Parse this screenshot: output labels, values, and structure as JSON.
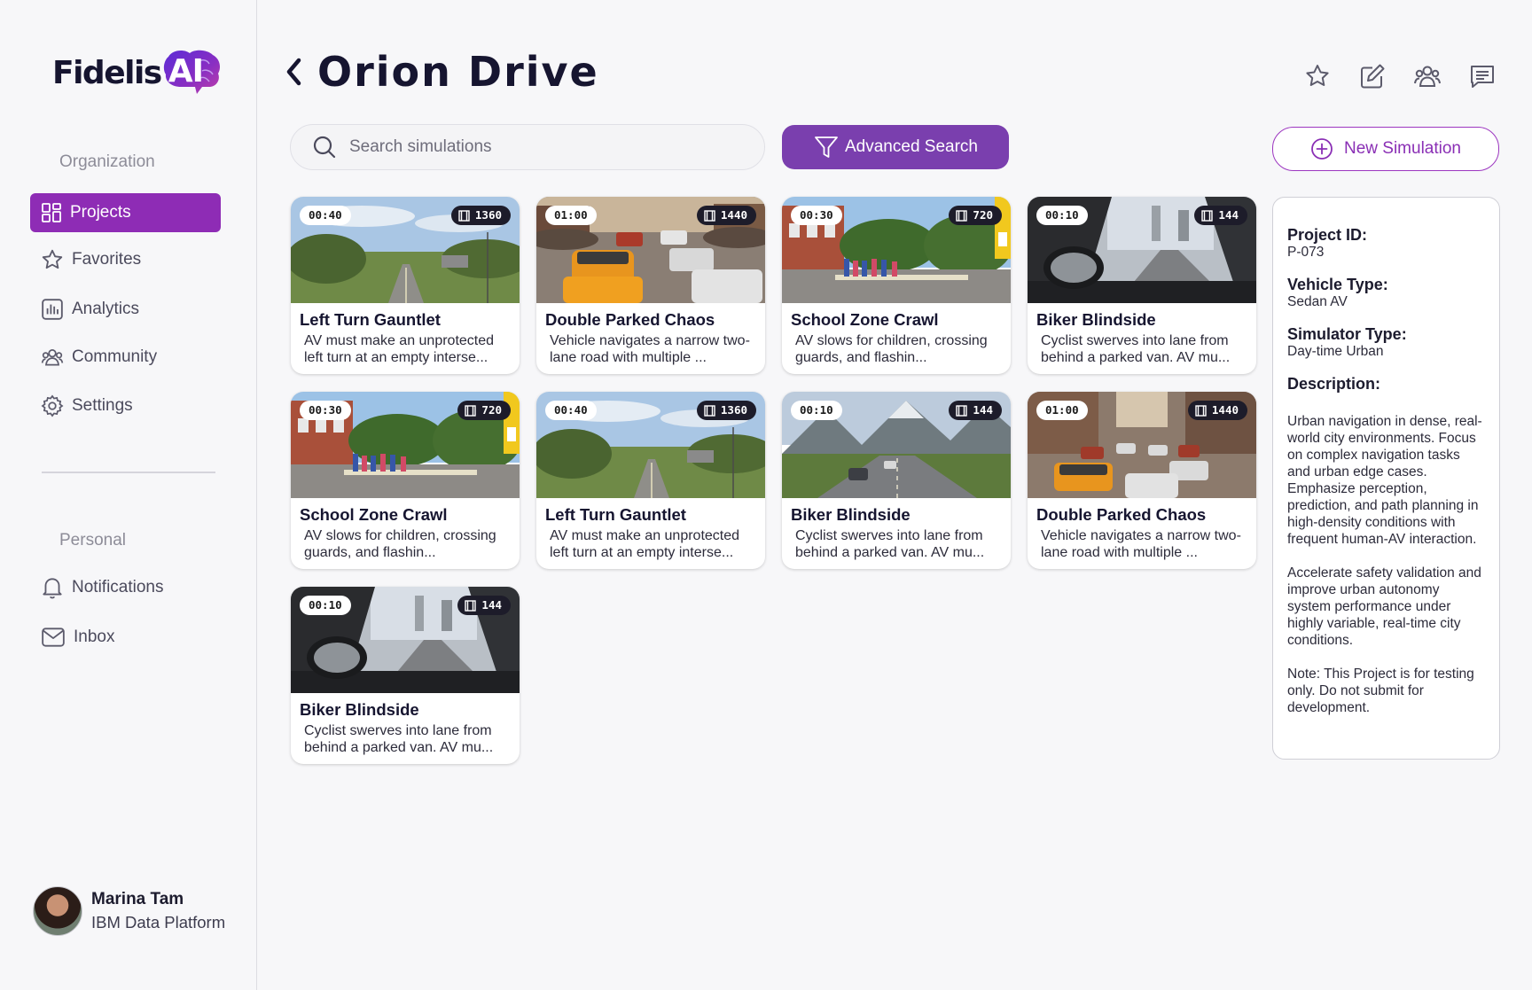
{
  "logo": {
    "text": "Fidelis",
    "badge": "AI"
  },
  "sidebar": {
    "org_label": "Organization",
    "items": [
      {
        "label": "Projects",
        "icon": "projects-icon",
        "active": true
      },
      {
        "label": "Favorites",
        "icon": "star-icon"
      },
      {
        "label": "Analytics",
        "icon": "analytics-icon"
      },
      {
        "label": "Community",
        "icon": "community-icon"
      },
      {
        "label": "Settings",
        "icon": "gear-icon"
      }
    ],
    "personal_label": "Personal",
    "personal_items": [
      {
        "label": "Notifications",
        "icon": "bell-icon"
      },
      {
        "label": "Inbox",
        "icon": "mail-icon"
      }
    ],
    "user": {
      "name": "Marina Tam",
      "org": "IBM Data Platform"
    }
  },
  "header": {
    "title": "Orion Drive",
    "icons": [
      "star-icon",
      "edit-icon",
      "team-icon",
      "chat-icon"
    ]
  },
  "toolbar": {
    "search_placeholder": "Search simulations",
    "advanced_label": "Advanced Search",
    "new_label": "New Simulation"
  },
  "cards": [
    {
      "title": "Left Turn Gauntlet",
      "desc": "AV must make an unprotected left turn at an empty interse...",
      "duration": "00:40",
      "frames": "1360",
      "scene": "rural"
    },
    {
      "title": "Double Parked Chaos",
      "desc": "Vehicle navigates a narrow two-lane road with multiple ...",
      "duration": "01:00",
      "frames": "1440",
      "scene": "traffic"
    },
    {
      "title": "School Zone Crawl",
      "desc": "AV slows for children, crossing guards, and flashin...",
      "duration": "00:30",
      "frames": "720",
      "scene": "school"
    },
    {
      "title": "Biker Blindside",
      "desc": "Cyclist swerves into lane from behind a parked van. AV mu...",
      "duration": "00:10",
      "frames": "144",
      "scene": "cockpit"
    },
    {
      "title": "School Zone Crawl",
      "desc": "AV slows for children, crossing guards, and flashin...",
      "duration": "00:30",
      "frames": "720",
      "scene": "school"
    },
    {
      "title": "Left Turn Gauntlet",
      "desc": "AV must make an unprotected left turn at an empty interse...",
      "duration": "00:40",
      "frames": "1360",
      "scene": "rural"
    },
    {
      "title": "Biker Blindside",
      "desc": "Cyclist swerves into lane from behind a parked van. AV mu...",
      "duration": "00:10",
      "frames": "144",
      "scene": "mountain"
    },
    {
      "title": "Double Parked Chaos",
      "desc": "Vehicle navigates a narrow two-lane road with multiple ...",
      "duration": "01:00",
      "frames": "1440",
      "scene": "city"
    },
    {
      "title": "Biker Blindside",
      "desc": "Cyclist swerves into lane from behind a parked van. AV mu...",
      "duration": "00:10",
      "frames": "144",
      "scene": "cockpit"
    }
  ],
  "project": {
    "id_label": "Project ID:",
    "id": "P-073",
    "vehicle_label": "Vehicle Type:",
    "vehicle": "Sedan AV",
    "simulator_label": "Simulator Type:",
    "simulator": "Day-time Urban",
    "description_label": "Description:",
    "description": [
      "Urban navigation in dense, real-world city environments. Focus on complex navigation tasks and urban edge cases. Emphasize perception, prediction, and path planning in high-density conditions with frequent human-AV interaction.",
      "Accelerate safety validation and improve urban autonomy system performance under highly variable, real-time city conditions.",
      "Note: This Project is for testing only. Do not submit for development."
    ]
  },
  "colors": {
    "accent": "#8e2cb5",
    "advanced_button": "#7a3fae",
    "title": "#161530"
  }
}
